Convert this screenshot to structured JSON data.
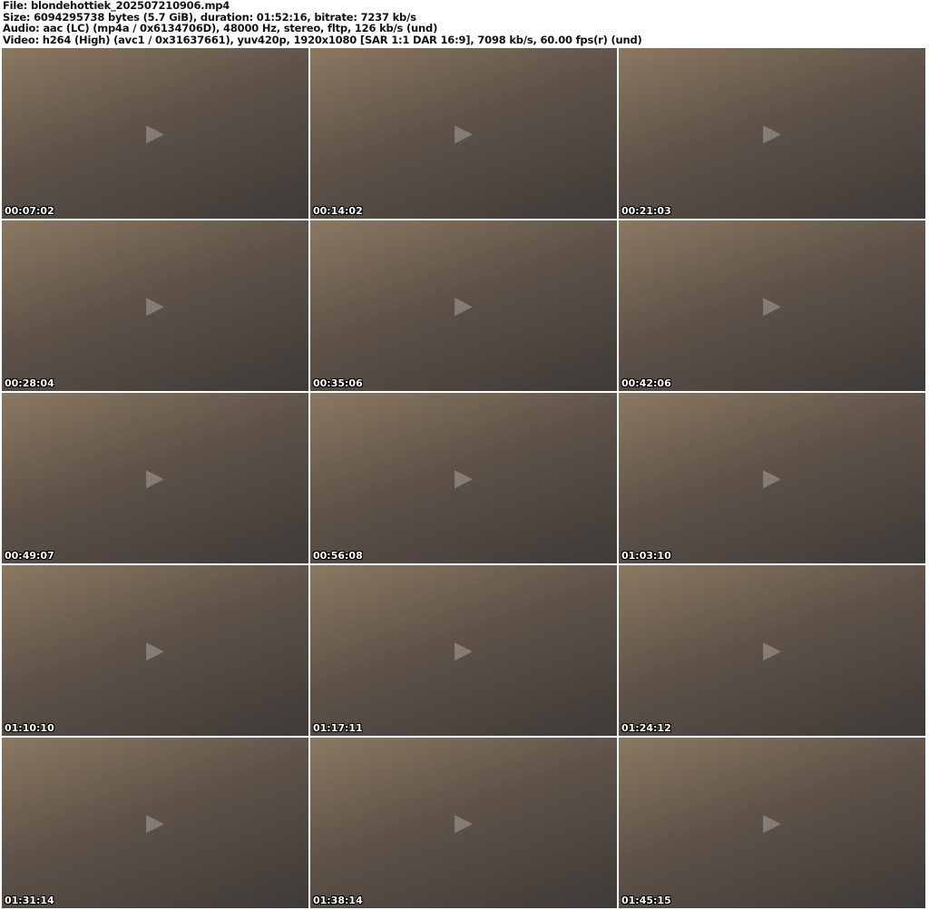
{
  "header": {
    "file": "File: blondehottiek_202507210906.mp4",
    "size": "Size: 6094295738 bytes (5.7 GiB), duration: 01:52:16, bitrate: 7237 kb/s",
    "audio": "Audio: aac (LC) (mp4a / 0x6134706D), 48000 Hz, stereo, fltp, 126 kb/s (und)",
    "video": "Video: h264 (High) (avc1 / 0x31637661), yuv420p, 1920x1080 [SAR 1:1 DAR 16:9], 7098 kb/s, 60.00 fps(r) (und)"
  },
  "thumbnails": [
    {
      "timestamp": "00:07:02"
    },
    {
      "timestamp": "00:14:02"
    },
    {
      "timestamp": "00:21:03"
    },
    {
      "timestamp": "00:28:04"
    },
    {
      "timestamp": "00:35:06"
    },
    {
      "timestamp": "00:42:06"
    },
    {
      "timestamp": "00:49:07"
    },
    {
      "timestamp": "00:56:08"
    },
    {
      "timestamp": "01:03:10"
    },
    {
      "timestamp": "01:10:10"
    },
    {
      "timestamp": "01:17:11"
    },
    {
      "timestamp": "01:24:12"
    },
    {
      "timestamp": "01:31:14"
    },
    {
      "timestamp": "01:38:14"
    },
    {
      "timestamp": "01:45:15"
    }
  ]
}
